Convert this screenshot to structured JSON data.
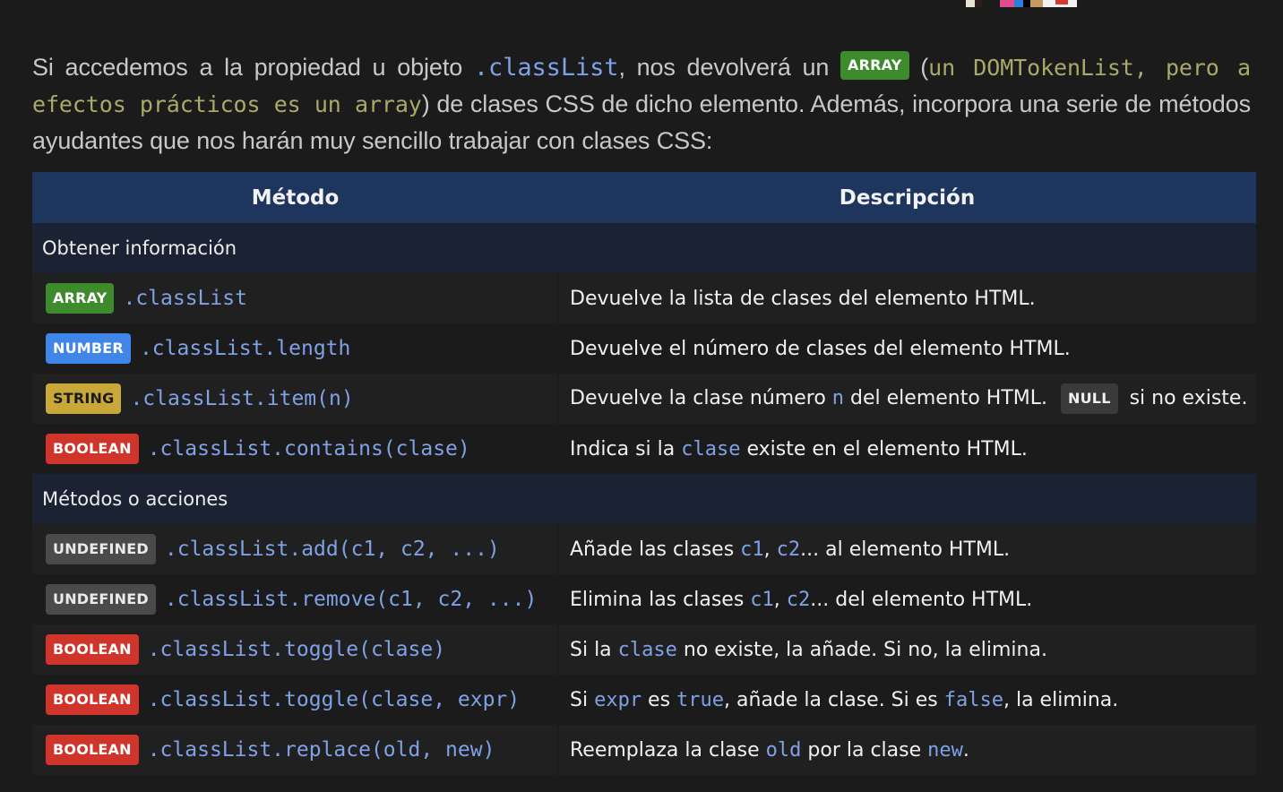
{
  "intro": {
    "p1": "Si accedemos a la propiedad u objeto ",
    "code_classlist": ".classList",
    "p2": ", nos devolverá un ",
    "badge_array": "ARRAY",
    "paren_open": " (",
    "note": "un DOMTokenList, pero a efectos prácticos es un array",
    "paren_close": ")",
    "p3": " de clases CSS de dicho elemento. Además, incorpora una serie de métodos ayudantes que nos harán muy sencillo trabajar con clases CSS:"
  },
  "table": {
    "headers": {
      "method": "Método",
      "description": "Descripción"
    },
    "group1": "Obtener información",
    "group2": "Métodos o acciones",
    "rows": [
      {
        "type": "ARRAY",
        "method": ".classList",
        "desc": [
          "Devuelve la lista de clases del elemento HTML."
        ]
      },
      {
        "type": "NUMBER",
        "method": ".classList.length",
        "desc": [
          "Devuelve el número de clases del elemento HTML."
        ]
      },
      {
        "type": "STRING",
        "method": ".classList.item(n)",
        "desc": [
          "Devuelve la clase número ",
          "n",
          " del elemento HTML. ",
          "NULL",
          " si no existe."
        ]
      },
      {
        "type": "BOOLEAN",
        "method": ".classList.contains(clase)",
        "desc": [
          "Indica si la ",
          "clase",
          " existe en el elemento HTML."
        ]
      },
      {
        "type": "UNDEFINED",
        "method": ".classList.add(c1, c2, ...)",
        "desc": [
          "Añade las clases ",
          "c1",
          ", ",
          "c2",
          "... al elemento HTML."
        ]
      },
      {
        "type": "UNDEFINED",
        "method": ".classList.remove(c1, c2, ...)",
        "desc": [
          "Elimina las clases ",
          "c1",
          ", ",
          "c2",
          "... del elemento HTML."
        ]
      },
      {
        "type": "BOOLEAN",
        "method": ".classList.toggle(clase)",
        "desc": [
          "Si la ",
          "clase",
          " no existe, la añade. Si no, la elimina."
        ]
      },
      {
        "type": "BOOLEAN",
        "method": ".classList.toggle(clase, expr)",
        "desc": [
          "Si ",
          "expr",
          " es ",
          "true",
          ", añade la clase. Si es ",
          "false",
          ", la elimina."
        ]
      },
      {
        "type": "BOOLEAN",
        "method": ".classList.replace(old, new)",
        "desc": [
          "Reemplaza la clase ",
          "old",
          " por la clase ",
          "new",
          "."
        ]
      }
    ]
  },
  "colors": {
    "background": "#1b1b1b",
    "header": "#1e355e",
    "group_row": "#1b2233",
    "code_blue": "#7fa2e6",
    "array": "#3d8b2d",
    "number": "#3f86e8",
    "string": "#c9a83a",
    "boolean": "#d0352b",
    "undefined": "#4a4a4a"
  }
}
